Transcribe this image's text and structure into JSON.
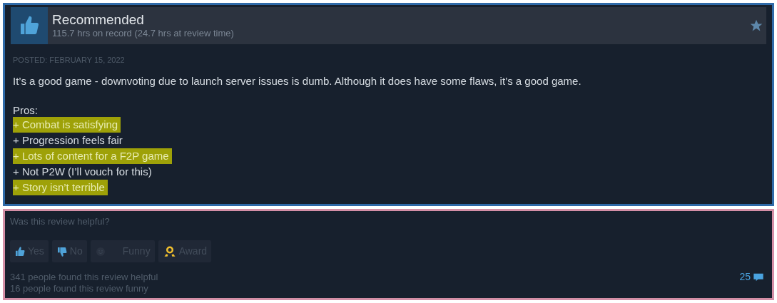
{
  "review": {
    "verdict": "Recommended",
    "hours": "115.7 hrs on record (24.7 hrs at review time)",
    "posted": "POSTED: FEBRUARY 15, 2022",
    "body": "It’s a good game - downvoting due to launch server issues is dumb. Although it does have some flaws, it’s a good game.",
    "list_title": "Pros:",
    "lines": [
      {
        "text": "+ Combat is satisfying",
        "highlighted": true
      },
      {
        "text": "+ Progression feels fair",
        "highlighted": false
      },
      {
        "text": "+ Lots of content for a F2P game",
        "highlighted": true
      },
      {
        "text": "+ Not P2W (I’ll vouch for this)",
        "highlighted": false
      },
      {
        "text": "+ Story isn’t terrible",
        "highlighted": true
      }
    ]
  },
  "feedback": {
    "question": "Was this review helpful?",
    "buttons": [
      {
        "kind": "yes",
        "label": "Yes"
      },
      {
        "kind": "no",
        "label": "No"
      },
      {
        "kind": "funny",
        "label": "Funny"
      },
      {
        "kind": "award",
        "label": "Award"
      }
    ],
    "helpful": "341 people found this review helpful",
    "funny": "16 people found this review funny",
    "comments": "25"
  }
}
